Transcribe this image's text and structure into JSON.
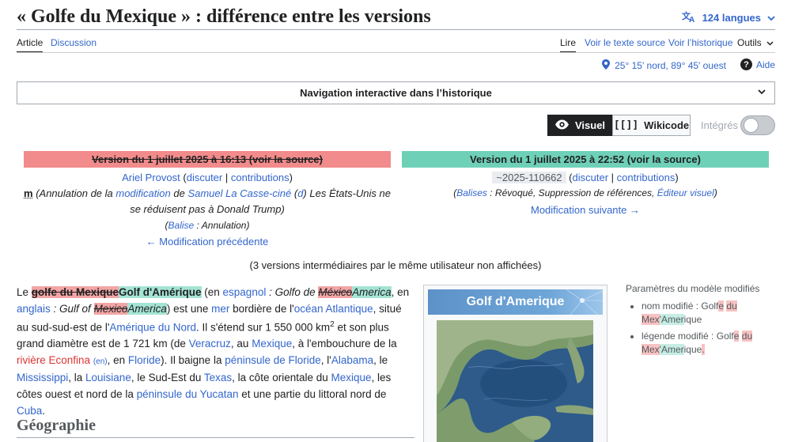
{
  "header": {
    "title": "« Golfe du Mexique » : différence entre les versions",
    "languages": "124 langues"
  },
  "tabs": {
    "article": "Article",
    "discussion": "Discussion",
    "lire": "Lire",
    "source": "Voir le texte source",
    "history": "Voir l’historique",
    "tools": "Outils"
  },
  "coords": {
    "text": "25° 15′ nord, 89° 45′ ouest",
    "help": "Aide"
  },
  "nav": {
    "label": "Navigation interactive dans l’historique"
  },
  "modes": {
    "visual": "Visuel",
    "wikicode": "Wikicode",
    "inline": "Intégrés"
  },
  "old": {
    "heading": "Version du 1 juillet 2025 à 16:13 (voir la source)",
    "user": "Ariel Provost",
    "talk": "discuter",
    "contribs": "contributions",
    "minor": "m",
    "summary_prefix": "(Annulation de la ",
    "summary_link1": "modification",
    "summary_mid": " de ",
    "summary_link2": "Samuel La Casse-ciné",
    "summary_d": "d",
    "summary_rest": " Les États-Unis ne se réduisent pas à Donald Trump)",
    "tag_link": "Balise",
    "tag_text": " : Annulation",
    "prev": "← Modification précédente"
  },
  "new": {
    "heading": "Version du 1 juillet 2025 à 22:52 (voir la source)",
    "user": "~2025-110662",
    "talk": "discuter",
    "contribs": "contributions",
    "tag_link": "Balises",
    "tag_text": " : Révoqué, Suppression de références, ",
    "tag_editor": "Éditeur visuel",
    "next": "Modification suivante →"
  },
  "intermediate": "(3 versions intermédiaires par le même utilisateur non affichées)",
  "article": {
    "le": "Le ",
    "del_name": "golfe du Mexique",
    "ins_name": "Golf d'Amérique",
    "en": " (en ",
    "espagnol": "espagnol",
    "golfo": " : Golfo de ",
    "mexico_del": "México",
    "america_ins": "America",
    "en2": ", en ",
    "anglais": "anglais",
    "gulf": " : Gulf of ",
    "mexico_del2": "Mexico",
    "america_ins2": "America",
    "t1": ") est une ",
    "mer": "mer",
    "t2": " bordière de l'",
    "ocean": "océan Atlantique",
    "t3": ", situé au sud-sud-est de l'",
    "amerique_nord": "Amérique du Nord",
    "t4": ". Il s'étend sur 1 550 000 km",
    "sup": "2",
    "t5": " et son plus grand diamètre est de 1 721 km (de ",
    "veracruz": "Veracruz",
    "t6": ", au ",
    "mexique1": "Mexique",
    "t7": ", à l'embouchure de la ",
    "riviere": "rivière Econfina",
    "en_tag": "(en)",
    "t8": ", en ",
    "floride1": "Floride",
    "t9": "). Il baigne la ",
    "peninsule_floride": "péninsule de Floride",
    "t10": ", l'",
    "alabama": "Alabama",
    "t11": ", le ",
    "mississippi": "Mississippi",
    "t12": ", la ",
    "louisiane": "Louisiane",
    "t13": ", le Sud-Est du ",
    "texas": "Texas",
    "t14": ", la côte orientale du ",
    "mexique2": "Mexique",
    "t15": ", les côtes ouest et nord de la ",
    "yucatan": "péninsule du Yucatan",
    "t16": " et une partie du littoral nord de ",
    "cuba": "Cuba",
    "t17": "."
  },
  "section": "Géographie",
  "infobox": {
    "title": "Golf d'Amerique"
  },
  "params": {
    "heading": "Paramètres du modèle modifiés",
    "item1_label": "nom modifié : Golf",
    "item1_del1": "e",
    "item1_sp": " ",
    "item1_del2": "du",
    "item1_del3": "Mex",
    "item1_ins": "'Amer",
    "item1_end": "ique",
    "item2_label": "légende modifié : Golf",
    "item2_del1": "e",
    "item2_sp": " ",
    "item2_del2": "du",
    "item2_del3": "Mex",
    "item2_ins": "'Amer",
    "item2_end": "ique",
    "item2_del4": "."
  },
  "colors": {
    "old_header": "#f28b8b",
    "new_header": "#6fd0b8",
    "link": "#3366cc"
  }
}
